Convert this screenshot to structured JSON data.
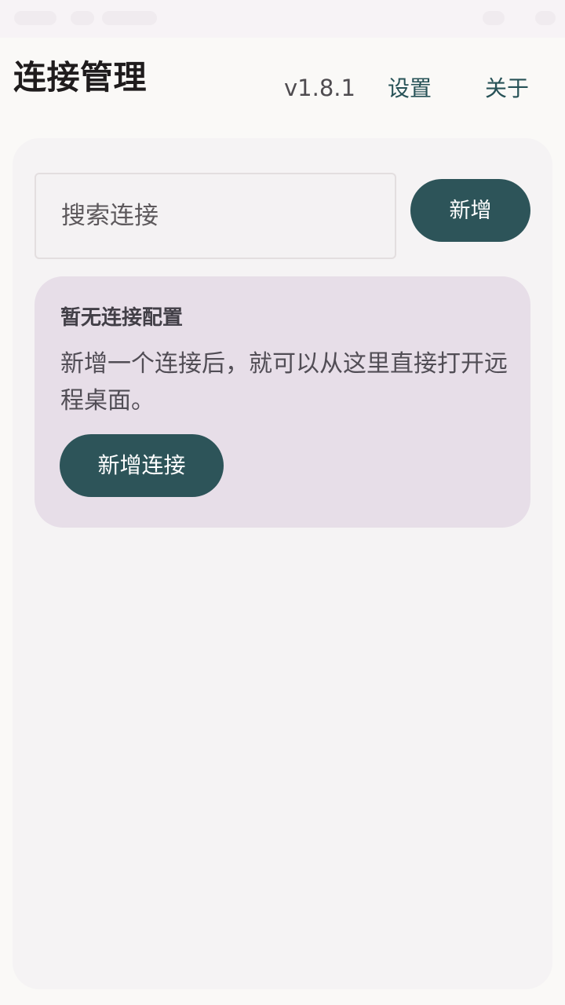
{
  "header": {
    "title": "连接管理",
    "version": "v1.8.1",
    "settings_label": "设置",
    "about_label": "关于"
  },
  "search": {
    "value": "",
    "placeholder": "搜索连接"
  },
  "toolbar": {
    "add_label": "新增"
  },
  "empty_state": {
    "title": "暂无连接配置",
    "description": "新增一个连接后，就可以从这里直接打开远程桌面。",
    "button_label": "新增连接"
  },
  "colors": {
    "background": "#FAF9F7",
    "panel": "#F5F3F4",
    "accent": "#2D5459",
    "empty_card": "#E7DEE8",
    "link": "#275257"
  }
}
